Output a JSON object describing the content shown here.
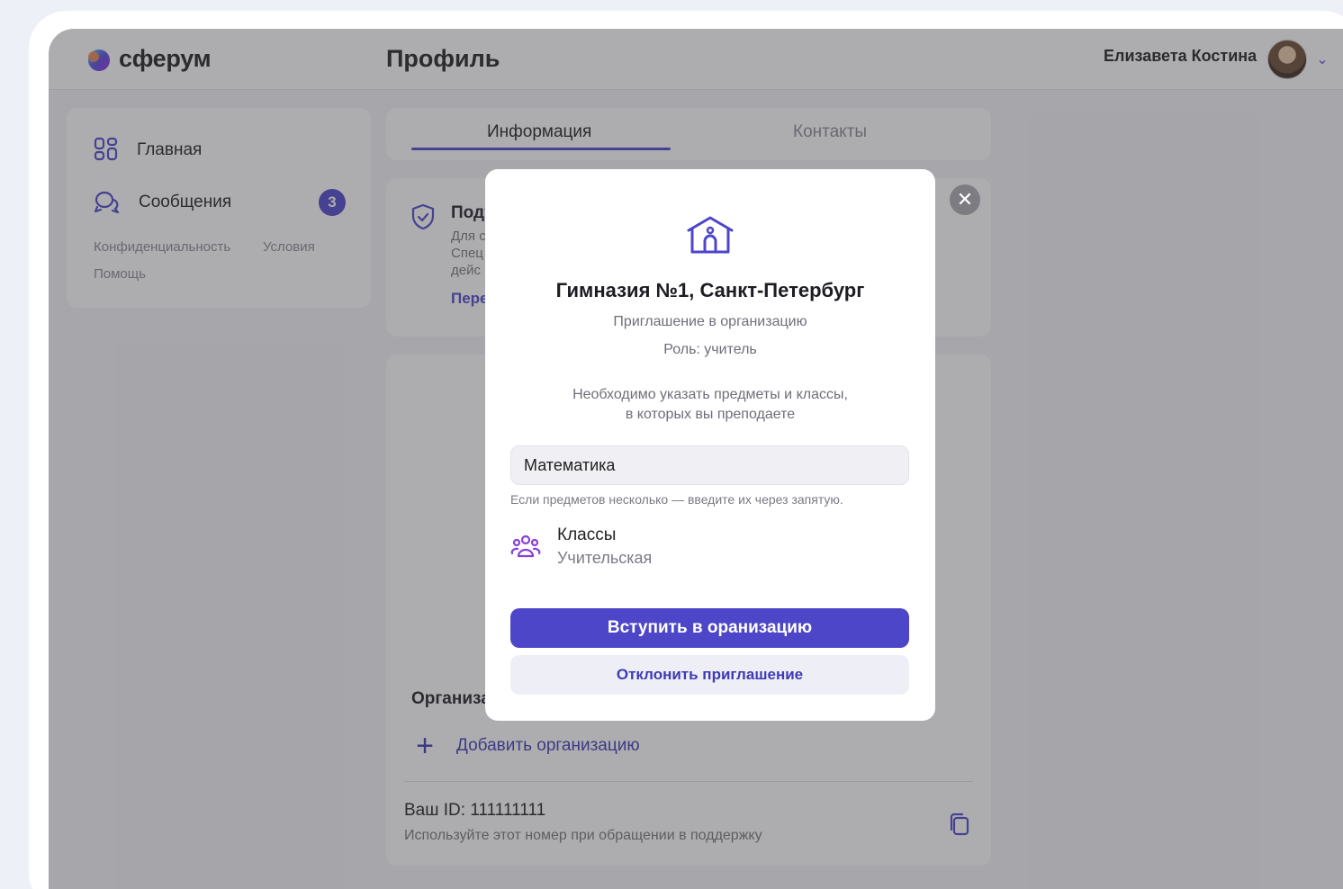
{
  "app": {
    "logo_text": "сферум",
    "page_title": "Профиль",
    "user_name": "Елизавета Костина"
  },
  "sidebar": {
    "items": [
      {
        "label": "Главная",
        "icon": "grid-icon"
      },
      {
        "label": "Сообщения",
        "icon": "chat-icon",
        "badge": "3"
      }
    ],
    "footer_links": [
      "Конфиденциальность",
      "Условия",
      "Помощь"
    ]
  },
  "tabs": [
    {
      "label": "Информация",
      "active": true
    },
    {
      "label": "Контакты",
      "active": false
    }
  ],
  "verify": {
    "title": "Подт",
    "lines": [
      "Для с",
      "Спец",
      "дейс"
    ],
    "link": "Пере"
  },
  "organizations": {
    "title": "Организа",
    "add_label": "Добавить организацию",
    "id_line": "Ваш ID: 111111111",
    "id_hint": "Используйте этот номер при обращении в поддержку"
  },
  "modal": {
    "title": "Гимназия №1, Санкт-Петербург",
    "subtitle": "Приглашение в организацию",
    "role": "Роль: учитель",
    "info_line1": "Необходимо указать предметы и классы,",
    "info_line2": "в которых вы преподаете",
    "subject_value": "Математика",
    "subject_hint": "Если предметов несколько — введите их через запятую.",
    "classes_title": "Классы",
    "classes_value": "Учительская",
    "join_label": "Вступить в оранизацию",
    "decline_label": "Отклонить приглашение"
  },
  "colors": {
    "accent": "#4e46c8",
    "badge": "#4e46c8",
    "link": "#3f3ab4"
  }
}
